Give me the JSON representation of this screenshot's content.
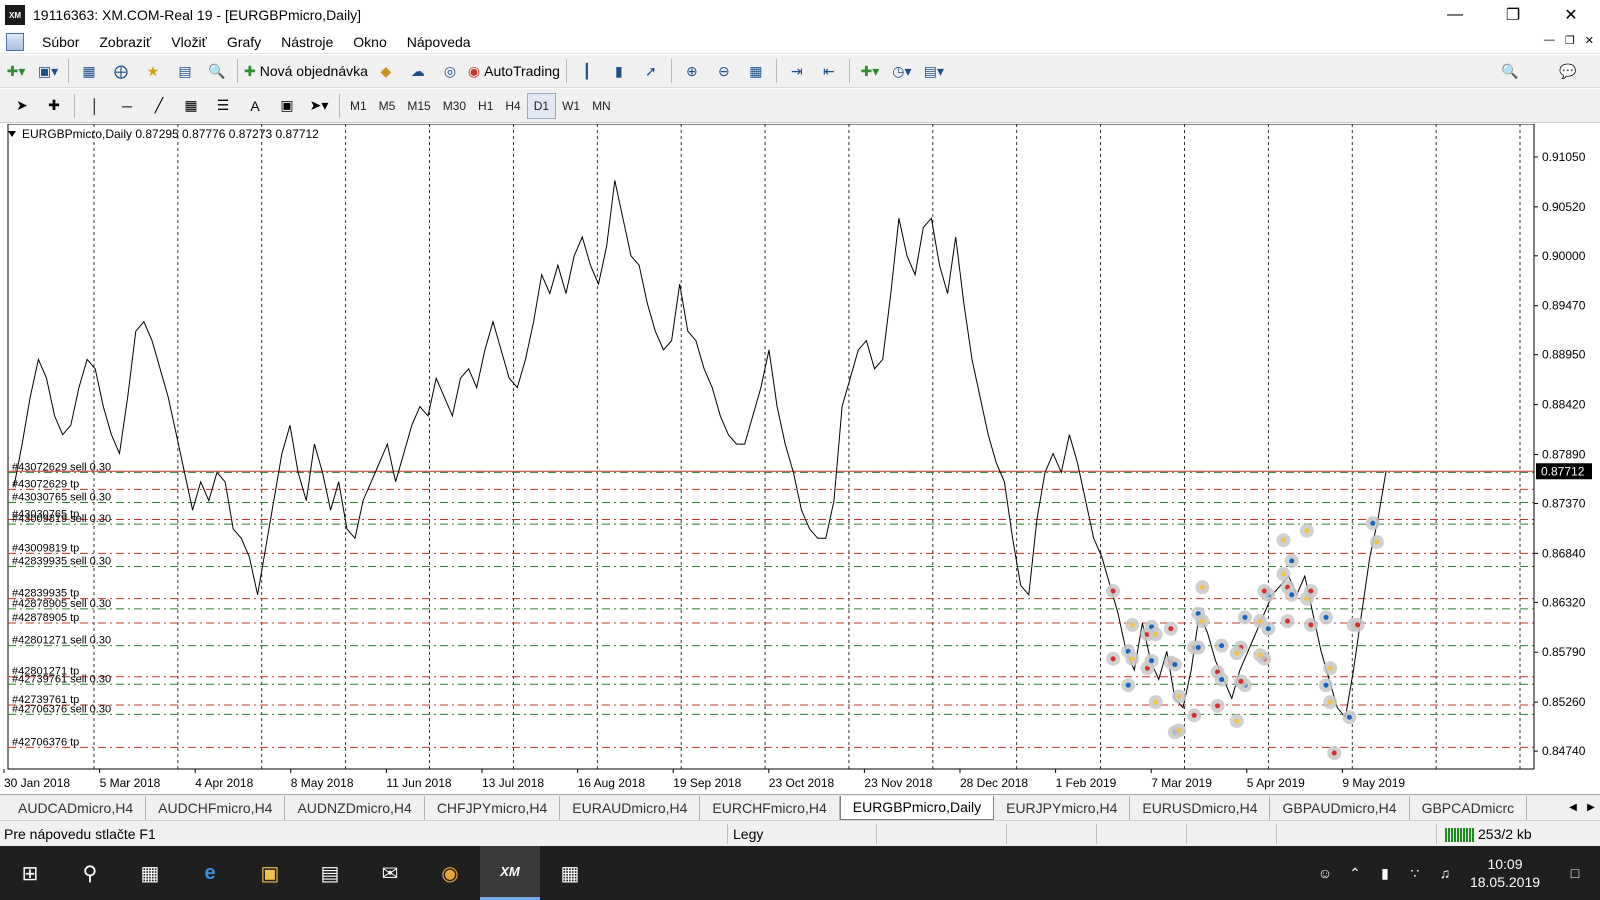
{
  "window": {
    "title": "19116363: XM.COM-Real 19 - [EURGBPmicro,Daily]",
    "app_icon_text": "XM"
  },
  "menu": [
    "Súbor",
    "Zobraziť",
    "Vložiť",
    "Grafy",
    "Nástroje",
    "Okno",
    "Nápoveda"
  ],
  "toolbar": {
    "new_order_label": "Nová objednávka",
    "autotrading_label": "AutoTrading",
    "timeframes": [
      "M1",
      "M5",
      "M15",
      "M30",
      "H1",
      "H4",
      "D1",
      "W1",
      "MN"
    ],
    "active_timeframe": "D1"
  },
  "chart_data": {
    "type": "line",
    "symbol_header": "EURGBPmicro,Daily  0.87295 0.87776 0.87273 0.87712",
    "current_price": "0.87712",
    "y_ticks": [
      "0.91050",
      "0.90520",
      "0.90000",
      "0.89470",
      "0.88950",
      "0.88420",
      "0.87890",
      "0.87370",
      "0.86840",
      "0.86320",
      "0.85790",
      "0.85260",
      "0.84740"
    ],
    "x_ticks": [
      "30 Jan 2018",
      "5 Mar 2018",
      "4 Apr 2018",
      "8 May 2018",
      "11 Jun 2018",
      "13 Jul 2018",
      "16 Aug 2018",
      "19 Sep 2018",
      "23 Oct 2018",
      "23 Nov 2018",
      "28 Dec 2018",
      "1 Feb 2019",
      "7 Mar 2019",
      "5 Apr 2019",
      "9 May 2019"
    ],
    "ylim": [
      0.8455,
      0.914
    ],
    "series_close": [
      0.8755,
      0.88,
      0.885,
      0.889,
      0.887,
      0.883,
      0.881,
      0.882,
      0.886,
      0.889,
      0.888,
      0.884,
      0.881,
      0.879,
      0.885,
      0.892,
      0.893,
      0.891,
      0.888,
      0.885,
      0.881,
      0.877,
      0.873,
      0.876,
      0.874,
      0.877,
      0.876,
      0.871,
      0.87,
      0.868,
      0.864,
      0.869,
      0.874,
      0.879,
      0.882,
      0.877,
      0.874,
      0.88,
      0.877,
      0.873,
      0.876,
      0.871,
      0.87,
      0.874,
      0.876,
      0.878,
      0.88,
      0.876,
      0.879,
      0.882,
      0.884,
      0.883,
      0.887,
      0.885,
      0.883,
      0.887,
      0.888,
      0.886,
      0.89,
      0.893,
      0.89,
      0.887,
      0.886,
      0.889,
      0.893,
      0.898,
      0.896,
      0.899,
      0.896,
      0.9,
      0.902,
      0.899,
      0.897,
      0.901,
      0.908,
      0.904,
      0.9,
      0.899,
      0.895,
      0.892,
      0.89,
      0.891,
      0.897,
      0.892,
      0.891,
      0.888,
      0.886,
      0.883,
      0.881,
      0.88,
      0.88,
      0.883,
      0.886,
      0.89,
      0.884,
      0.88,
      0.877,
      0.873,
      0.871,
      0.87,
      0.87,
      0.874,
      0.884,
      0.887,
      0.89,
      0.891,
      0.888,
      0.889,
      0.896,
      0.904,
      0.9,
      0.898,
      0.903,
      0.904,
      0.899,
      0.896,
      0.902,
      0.895,
      0.889,
      0.885,
      0.881,
      0.878,
      0.876,
      0.87,
      0.865,
      0.864,
      0.872,
      0.877,
      0.879,
      0.877,
      0.881,
      0.878,
      0.874,
      0.87,
      0.868,
      0.865,
      0.862,
      0.858,
      0.856,
      0.861,
      0.857,
      0.855,
      0.858,
      0.853,
      0.852,
      0.856,
      0.862,
      0.86,
      0.857,
      0.855,
      0.853,
      0.856,
      0.858,
      0.86,
      0.862,
      0.864,
      0.865,
      0.866,
      0.864,
      0.866,
      0.862,
      0.858,
      0.855,
      0.852,
      0.851,
      0.856,
      0.862,
      0.868,
      0.872,
      0.8771
    ],
    "x_grid": [
      "30 Jan 2018",
      "20 Feb 2018",
      "20 Mar 2018",
      "17 Apr 2018",
      "16 May 2018",
      "14 Jun 2018",
      "12 Jul 2018",
      "9 Aug 2018",
      "7 Sep 2018",
      "4 Oct 2018",
      "1 Nov 2018",
      "29 Nov 2018",
      "3 Jan 2019",
      "1 Feb 2019",
      "1 Mar 2019",
      "29 Mar 2019",
      "29 Apr 2019",
      "27 May 2019"
    ],
    "order_levels": [
      {
        "label": "#43072629 sell 0.30",
        "price": 0.877,
        "color": "#2e7d32"
      },
      {
        "label": "#43072629 tp",
        "price": 0.8752,
        "color": "#c0392b"
      },
      {
        "label": "#43030765 sell 0.30",
        "price": 0.8738,
        "color": "#2e7d32"
      },
      {
        "label": "#43030765 tp",
        "price": 0.872,
        "color": "#c0392b"
      },
      {
        "label": "#43009819 sell 0.30",
        "price": 0.8715,
        "color": "#2e7d32"
      },
      {
        "label": "#43009819 tp",
        "price": 0.8684,
        "color": "#c0392b"
      },
      {
        "label": "#42839935 sell 0.30",
        "price": 0.867,
        "color": "#2e7d32"
      },
      {
        "label": "#42839935 tp",
        "price": 0.8636,
        "color": "#c0392b"
      },
      {
        "label": "#42878905 sell 0.30",
        "price": 0.8625,
        "color": "#2e7d32"
      },
      {
        "label": "#42878905 tp",
        "price": 0.861,
        "color": "#c0392b"
      },
      {
        "label": "#42801271 sell 0.30",
        "price": 0.8586,
        "color": "#2e7d32"
      },
      {
        "label": "#42801271 tp",
        "price": 0.8553,
        "color": "#c0392b"
      },
      {
        "label": "#42739761 sell 0.30",
        "price": 0.8545,
        "color": "#2e7d32"
      },
      {
        "label": "#42739761 tp",
        "price": 0.8523,
        "color": "#c0392b"
      },
      {
        "label": "#42706376 sell 0.30",
        "price": 0.8513,
        "color": "#2e7d32"
      },
      {
        "label": "#42706376 tp",
        "price": 0.8478,
        "color": "#c0392b"
      }
    ],
    "bid_line_color": "#c0392b",
    "price_line_color": "#000000"
  },
  "tabs": [
    "AUDCADmicro,H4",
    "AUDCHFmicro,H4",
    "AUDNZDmicro,H4",
    "CHFJPYmicro,H4",
    "EURAUDmicro,H4",
    "EURCHFmicro,H4",
    "EURGBPmicro,Daily",
    "EURJPYmicro,H4",
    "EURUSDmicro,H4",
    "GBPAUDmicro,H4",
    "GBPCADmicrc"
  ],
  "active_tab": "EURGBPmicro,Daily",
  "status": {
    "help": "Pre nápovedu stlačte F1",
    "profile": "Legy",
    "connection": "253/2 kb"
  },
  "taskbar": {
    "time": "10:09",
    "date": "18.05.2019",
    "xm_label": "XM"
  }
}
